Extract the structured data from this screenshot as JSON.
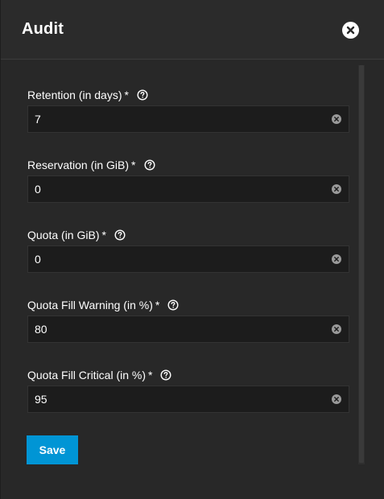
{
  "dialog": {
    "title": "Audit",
    "close_icon": "close-icon"
  },
  "fields": [
    {
      "label": "Retention (in days)",
      "required": "*",
      "value": "7"
    },
    {
      "label": "Reservation (in GiB)",
      "required": "*",
      "value": "0"
    },
    {
      "label": "Quota (in GiB)",
      "required": "*",
      "value": "0"
    },
    {
      "label": "Quota Fill Warning (in %)",
      "required": "*",
      "value": "80"
    },
    {
      "label": "Quota Fill Critical (in %)",
      "required": "*",
      "value": "95"
    }
  ],
  "actions": {
    "save_label": "Save"
  },
  "colors": {
    "background": "#282828",
    "input_background": "#1c1c1c",
    "primary": "#0095d5",
    "text": "#ffffff",
    "clear_icon": "#9a9a9a"
  },
  "icons": {
    "help": "help-circle-icon",
    "clear": "clear-input-icon"
  }
}
